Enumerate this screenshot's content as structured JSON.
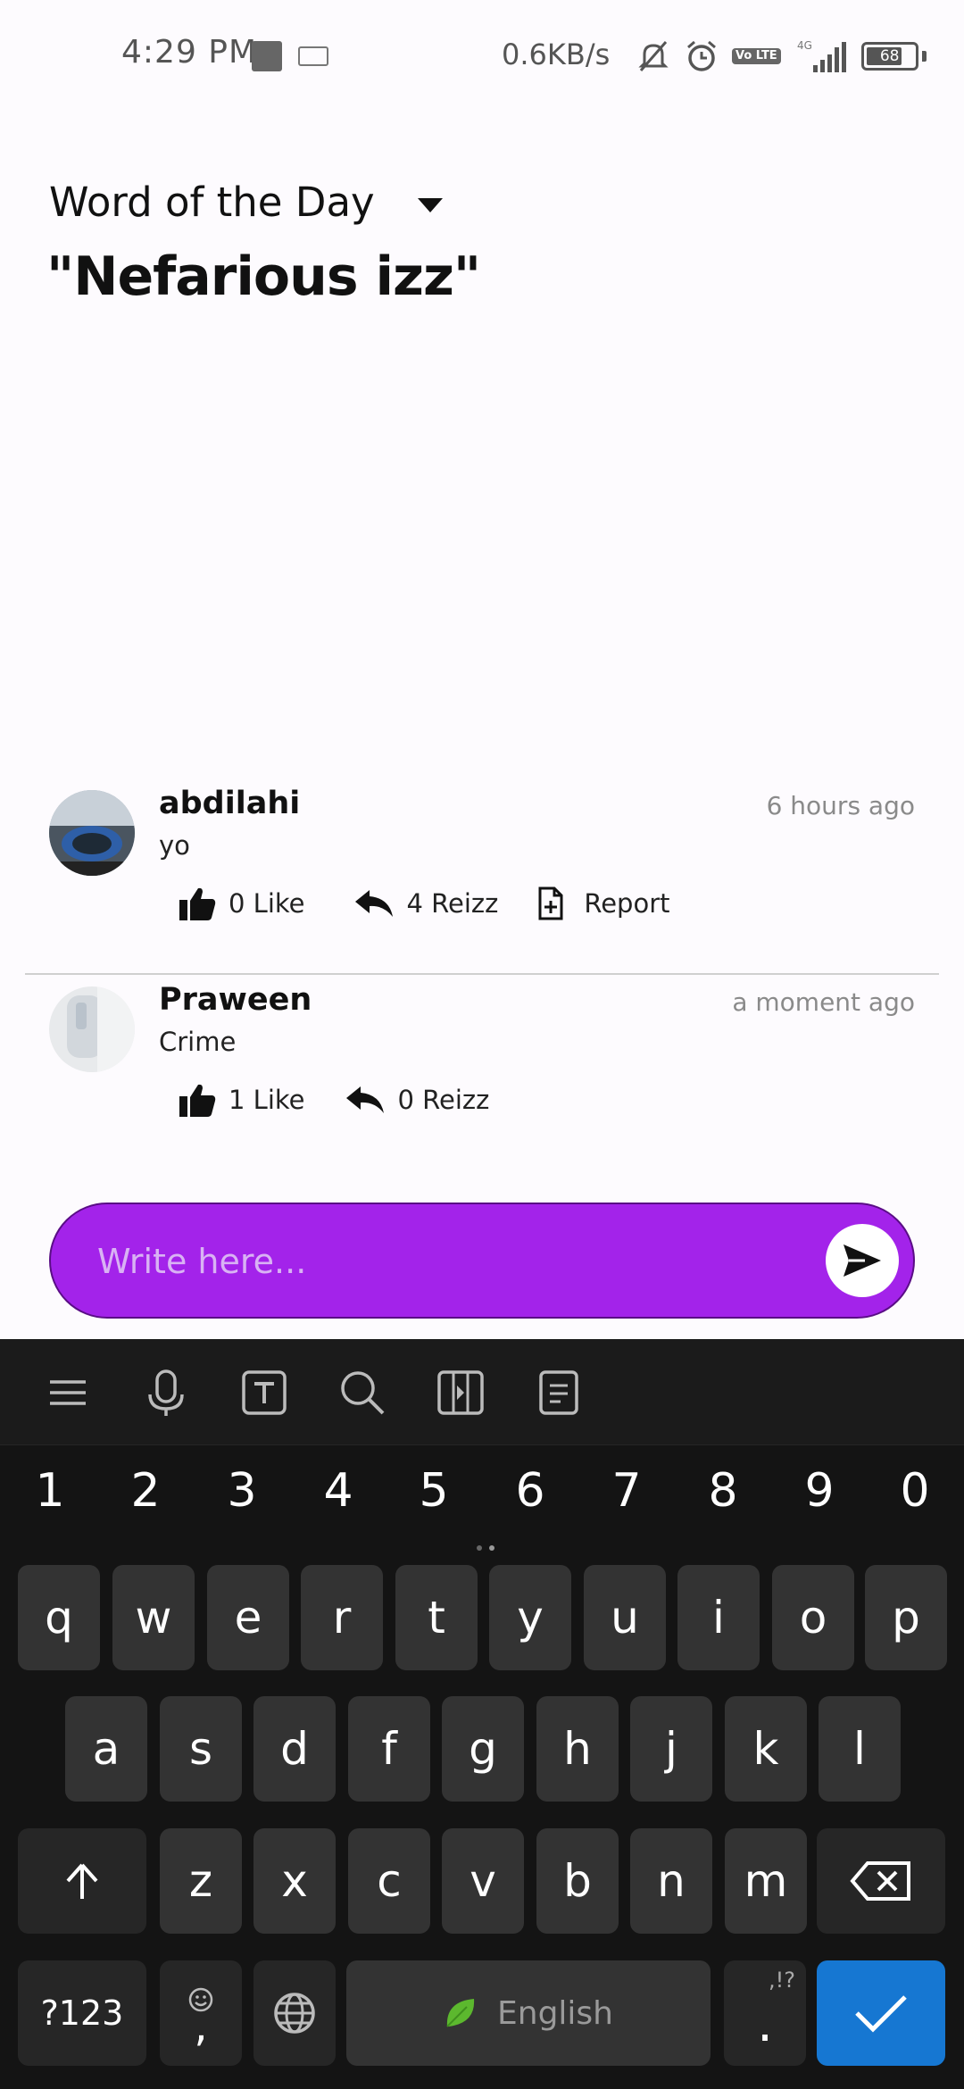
{
  "status_bar": {
    "time": "4:29 PM",
    "network_speed": "0.6KB/s",
    "network_type": "4G",
    "volte": "Vo LTE",
    "battery": "68"
  },
  "header": {
    "label": "Word of the Day",
    "word": "\"Nefarious izz\""
  },
  "comments": [
    {
      "user": "abdilahi",
      "time": "6 hours ago",
      "text": "yo",
      "like_label": "0 Like",
      "reply_label": "4 Reizz",
      "report_label": "Report"
    },
    {
      "user": "Praween",
      "time": "a moment ago",
      "text": "Crime",
      "like_label": "1 Like",
      "reply_label": "0 Reizz"
    }
  ],
  "composer": {
    "placeholder": "Write here..."
  },
  "keyboard": {
    "numbers": [
      "1",
      "2",
      "3",
      "4",
      "5",
      "6",
      "7",
      "8",
      "9",
      "0"
    ],
    "row1": [
      "q",
      "w",
      "e",
      "r",
      "t",
      "y",
      "u",
      "i",
      "o",
      "p"
    ],
    "row2": [
      "a",
      "s",
      "d",
      "f",
      "g",
      "h",
      "j",
      "k",
      "l"
    ],
    "row3": [
      "z",
      "x",
      "c",
      "v",
      "b",
      "n",
      "m"
    ],
    "symbols_label": "?123",
    "comma_label": ",",
    "period_label": ".",
    "punct_hint": ",!?",
    "space_label": "English"
  },
  "colors": {
    "accent": "#a323ea",
    "enter_key": "#1677d2"
  }
}
